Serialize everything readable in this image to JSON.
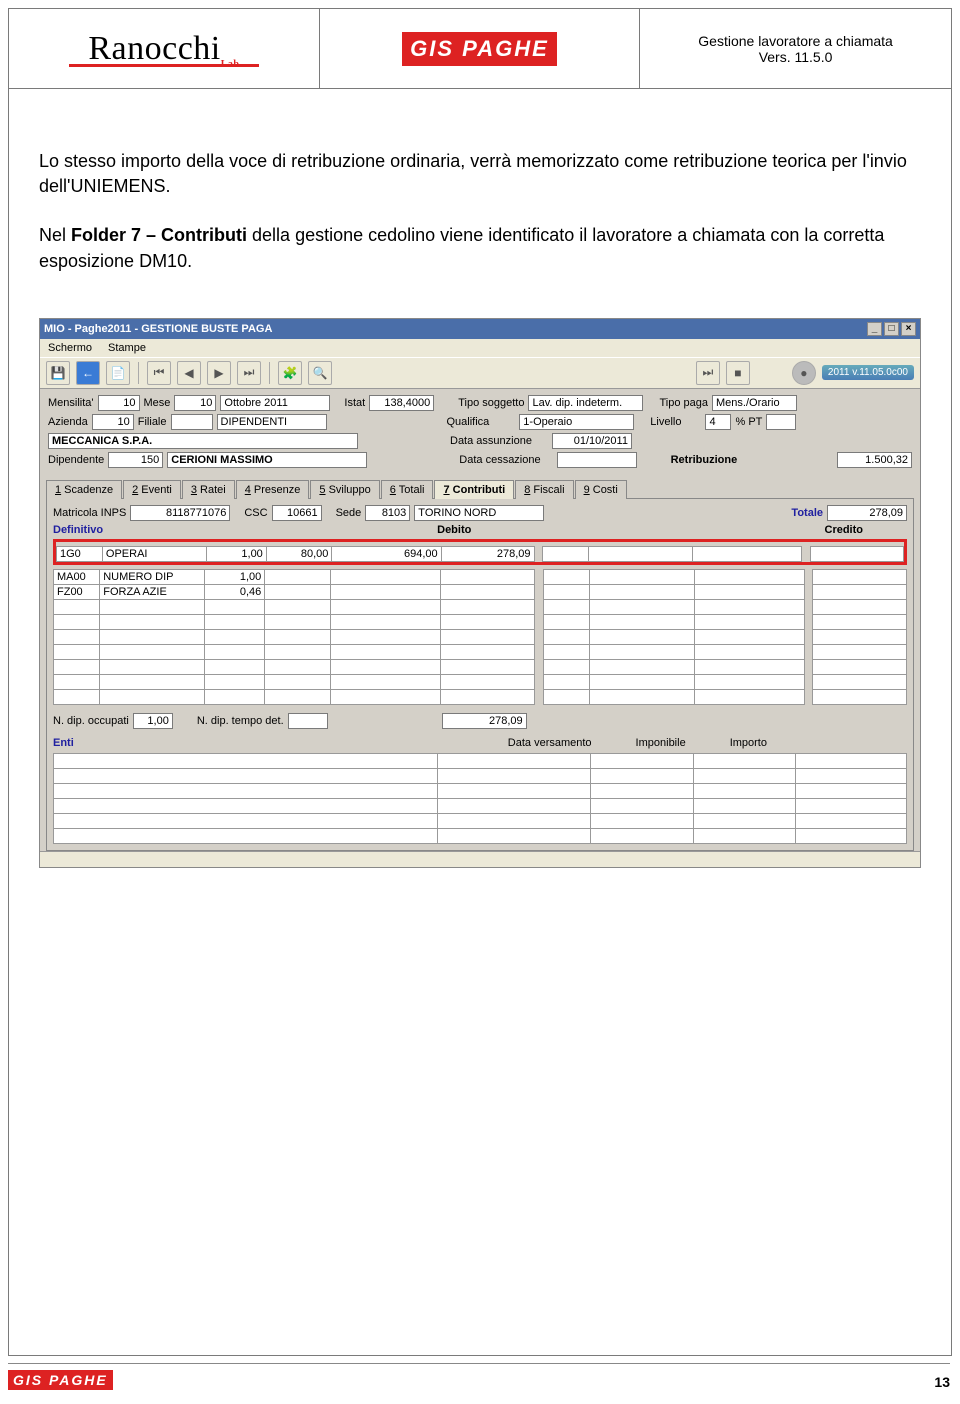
{
  "header": {
    "brand": "Ranocchi",
    "brand_sub": "Lab",
    "product": "GIS PAGHE",
    "doc_title": "Gestione lavoratore a chiamata",
    "doc_version": "Vers. 11.5.0"
  },
  "body": {
    "p1": "Lo stesso importo della voce di retribuzione ordinaria, verrà memorizzato come retribuzione teorica per l'invio dell'UNIEMENS.",
    "p2_a": "Nel ",
    "p2_b": "Folder 7 – Contributi",
    "p2_c": " della gestione cedolino viene identificato il lavoratore a chiamata con la corretta esposizione DM10."
  },
  "app": {
    "titlebar": "MIO - Paghe2011 - GESTIONE BUSTE PAGA",
    "menu": [
      "Schermo",
      "Stampe"
    ],
    "version_badge": "2011 v.11.05.0c00",
    "info": {
      "mensilita_lbl": "Mensilita'",
      "mensilita": "10",
      "mese_lbl": "Mese",
      "mese_num": "10",
      "mese_txt": "Ottobre  2011",
      "istat_lbl": "Istat",
      "istat": "138,4000",
      "tiposog_lbl": "Tipo soggetto",
      "tiposog": "Lav. dip. indeterm.",
      "tipopaga_lbl": "Tipo paga",
      "tipopaga": "Mens./Orario",
      "azienda_lbl": "Azienda",
      "azienda": "10",
      "filiale_lbl": "Filiale",
      "filiale": "",
      "filiale_txt": "DIPENDENTI",
      "qualifica_lbl": "Qualifica",
      "qualifica": "1-Operaio",
      "livello_lbl": "Livello",
      "livello": "4",
      "pt_lbl": "% PT",
      "pt": "",
      "ragsoc": "MECCANICA S.P.A.",
      "dataass_lbl": "Data assunzione",
      "dataass": "01/10/2011",
      "dip_lbl": "Dipendente",
      "dip_num": "150",
      "dip_name": "CERIONI MASSIMO",
      "datacess_lbl": "Data cessazione",
      "datacess": "",
      "retrib_lbl": "Retribuzione",
      "retrib": "1.500,32"
    },
    "tabs": [
      "1 Scadenze",
      "2 Eventi",
      "3 Ratei",
      "4 Presenze",
      "5 Sviluppo",
      "6 Totali",
      "7 Contributi",
      "8 Fiscali",
      "9 Costi"
    ],
    "contrib": {
      "matricola_lbl": "Matricola INPS",
      "matricola": "8118771076",
      "csc_lbl": "CSC",
      "csc": "10661",
      "sede_lbl": "Sede",
      "sede_code": "8103",
      "sede_txt": "TORINO NORD",
      "totale_lbl": "Totale",
      "totale": "278,09",
      "definitivo": "Definitivo",
      "debito": "Debito",
      "credito": "Credito",
      "rows": [
        {
          "c1": "1G0",
          "c2": "OPERAI",
          "c3": "1,00",
          "c4": "80,00",
          "c5": "694,00",
          "c6": "278,09",
          "hl": true
        },
        {
          "c1": "MA00",
          "c2": "NUMERO DIP",
          "c3": "1,00",
          "c4": "",
          "c5": "",
          "c6": ""
        },
        {
          "c1": "FZ00",
          "c2": "FORZA AZIE",
          "c3": "0,46",
          "c4": "",
          "c5": "",
          "c6": ""
        }
      ],
      "ndip_lbl": "N. dip. occupati",
      "ndip": "1,00",
      "ntempo_lbl": "N. dip. tempo det.",
      "ntempo": "",
      "sum_deb": "278,09",
      "enti": "Enti",
      "dataver": "Data versamento",
      "imponibile": "Imponibile",
      "importo": "Importo"
    }
  },
  "footer": {
    "product": "GIS PAGHE",
    "page": "13"
  }
}
